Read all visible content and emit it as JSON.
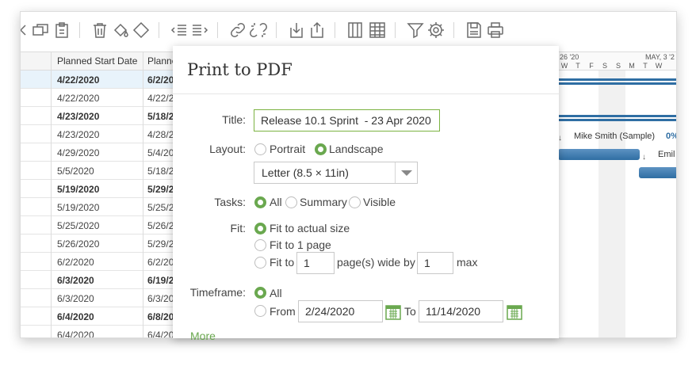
{
  "toolbar": {
    "icons": [
      "outdent-icon",
      "copy-icon",
      "paste-icon",
      "delete-icon",
      "fill-color-icon",
      "clear-format-icon",
      "decrease-indent-icon",
      "increase-indent-icon",
      "link-icon",
      "unlink-icon",
      "import-icon",
      "export-icon",
      "columns-icon",
      "table-icon",
      "filter-icon",
      "settings-icon",
      "save-icon",
      "print-icon"
    ]
  },
  "grid": {
    "columns": [
      "Planned Start Date",
      "Planne"
    ],
    "rows": [
      {
        "start": "4/22/2020",
        "end": "6/2/20",
        "bold": true,
        "selected": true
      },
      {
        "start": "4/22/2020",
        "end": "4/22/2",
        "bold": false
      },
      {
        "start": "4/23/2020",
        "end": "5/18/2",
        "bold": true
      },
      {
        "start": "4/23/2020",
        "end": "4/28/2",
        "bold": false
      },
      {
        "start": "4/29/2020",
        "end": "5/4/20",
        "bold": false
      },
      {
        "start": "5/5/2020",
        "end": "5/18/2",
        "bold": false
      },
      {
        "start": "5/19/2020",
        "end": "5/29/2",
        "bold": true
      },
      {
        "start": "5/19/2020",
        "end": "5/25/2",
        "bold": false
      },
      {
        "start": "5/25/2020",
        "end": "5/26/2",
        "bold": false
      },
      {
        "start": "5/26/2020",
        "end": "5/29/2",
        "bold": false
      },
      {
        "start": "6/2/2020",
        "end": "6/2/20",
        "bold": false
      },
      {
        "start": "6/3/2020",
        "end": "6/19/2",
        "bold": true
      },
      {
        "start": "6/3/2020",
        "end": "6/3/20",
        "bold": false
      },
      {
        "start": "6/4/2020",
        "end": "6/8/20",
        "bold": true
      },
      {
        "start": "6/4/2020",
        "end": "6/4/20",
        "bold": false
      }
    ]
  },
  "gantt": {
    "week1": "26 '20",
    "week2": "MAY, 3 '2",
    "days": [
      "W",
      "T",
      "F",
      "S",
      "S",
      "M",
      "T",
      "W"
    ],
    "assignee1": "Mike Smith (Sample)",
    "assignee1_pct": "0%",
    "assignee2": "Emil"
  },
  "dialog": {
    "title": "Print to PDF",
    "title_label": "Title:",
    "title_value": "Release 10.1 Sprint  - 23 Apr 2020",
    "layout_label": "Layout:",
    "portrait": "Portrait",
    "landscape": "Landscape",
    "paper": "Letter (8.5 × 11in)",
    "tasks_label": "Tasks:",
    "tasks_all": "All",
    "tasks_summary": "Summary",
    "tasks_visible": "Visible",
    "fit_label": "Fit:",
    "fit_actual": "Fit to actual size",
    "fit_one_page": "Fit to 1 page",
    "fit_to": "Fit to",
    "fit_wide_value": "1",
    "fit_pages_wide_by": "page(s) wide by",
    "fit_tall_value": "1",
    "fit_max": "max",
    "timeframe_label": "Timeframe:",
    "timeframe_all": "All",
    "timeframe_from": "From",
    "from_date": "2/24/2020",
    "timeframe_to": "To",
    "to_date": "11/14/2020",
    "more": "More",
    "accent_color": "#6aa84f"
  }
}
